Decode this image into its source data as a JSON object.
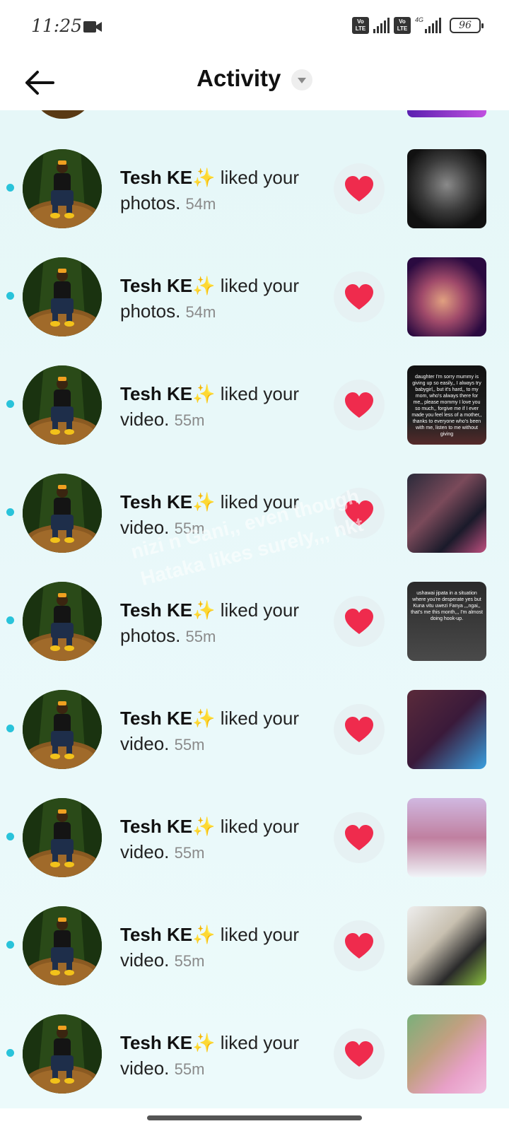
{
  "status_bar": {
    "time": "11:25",
    "volte1": "Vo LTE",
    "volte2": "Vo LTE",
    "network": "4G",
    "battery": "96"
  },
  "header": {
    "title": "Activity"
  },
  "watermark": {
    "line1": "nizi n Gani,, even though",
    "line2": "Hataka likes surely,,, nkt"
  },
  "notifications": [
    {
      "name": "Tesh KE✨",
      "action": "liked your",
      "object": "photos.",
      "time": "54m",
      "thumb_icon": "photo-portrait-braids"
    },
    {
      "name": "Tesh KE✨",
      "action": "liked your",
      "object": "photos.",
      "time": "54m",
      "thumb_icon": "photo-portrait-neon"
    },
    {
      "name": "Tesh KE✨",
      "action": "liked your",
      "object": "video.",
      "time": "55m",
      "thumb_icon": "video-text-caption",
      "thumb_caption": "daughter I'm sorry mummy is giving up so easily,, I always try babygirl,, but it's hard,, to my mom, who's always there for me,, please mommy I love you so much,, forgive me if I ever made you feel less of a mother,, thanks to everyone who's been with me, listen to me without giving"
    },
    {
      "name": "Tesh KE✨",
      "action": "liked your",
      "object": "video.",
      "time": "55m",
      "thumb_icon": "video-collage"
    },
    {
      "name": "Tesh KE✨",
      "action": "liked your",
      "object": "photos.",
      "time": "55m",
      "thumb_icon": "photo-text-caption",
      "thumb_caption": "ushawai jipata in a situation where you're desperate yes but Kuna vitu uwezi Fanya ,,,ngai,, that's me this month,,, I'm almost doing hook-up."
    },
    {
      "name": "Tesh KE✨",
      "action": "liked your",
      "object": "video.",
      "time": "55m",
      "thumb_icon": "video-dark-blue"
    },
    {
      "name": "Tesh KE✨",
      "action": "liked your",
      "object": "video.",
      "time": "55m",
      "thumb_icon": "video-portrait-selfie"
    },
    {
      "name": "Tesh KE✨",
      "action": "liked your",
      "object": "video.",
      "time": "55m",
      "thumb_icon": "video-two-people"
    },
    {
      "name": "Tesh KE✨",
      "action": "liked your",
      "object": "video.",
      "time": "55m",
      "thumb_icon": "video-pink-dress"
    }
  ],
  "colors": {
    "accent_dot": "#29c3da",
    "heart": "#ef2b4d",
    "list_bg": "#e6f7f8"
  }
}
